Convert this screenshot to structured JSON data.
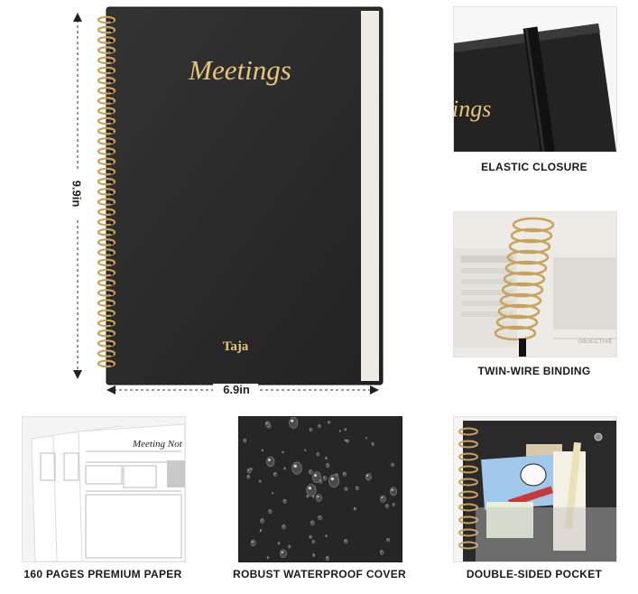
{
  "product": {
    "cover_title": "Meetings",
    "brand": "Taja",
    "height_label": "9.9in",
    "width_label": "6.9in"
  },
  "features": [
    {
      "caption": "ELASTIC CLOSURE",
      "image": "elastic-closure-closeup",
      "partial_title": "ings"
    },
    {
      "caption": "TWIN-WIRE BINDING",
      "image": "twin-wire-binding-closeup",
      "page_label": "OBJECTIVE"
    },
    {
      "caption": "160 PAGES PREMIUM PAPER",
      "image": "meeting-note-pages",
      "page_title": "Meeting Not"
    },
    {
      "caption": "ROBUST WATERPROOF COVER",
      "image": "water-droplets-on-cover"
    },
    {
      "caption": "DOUBLE-SIDED POCKET",
      "image": "back-pocket-with-cards"
    }
  ],
  "colors": {
    "cover": "#2b2b2b",
    "gold": "#e6c77a",
    "wire": "#c9a25a"
  }
}
